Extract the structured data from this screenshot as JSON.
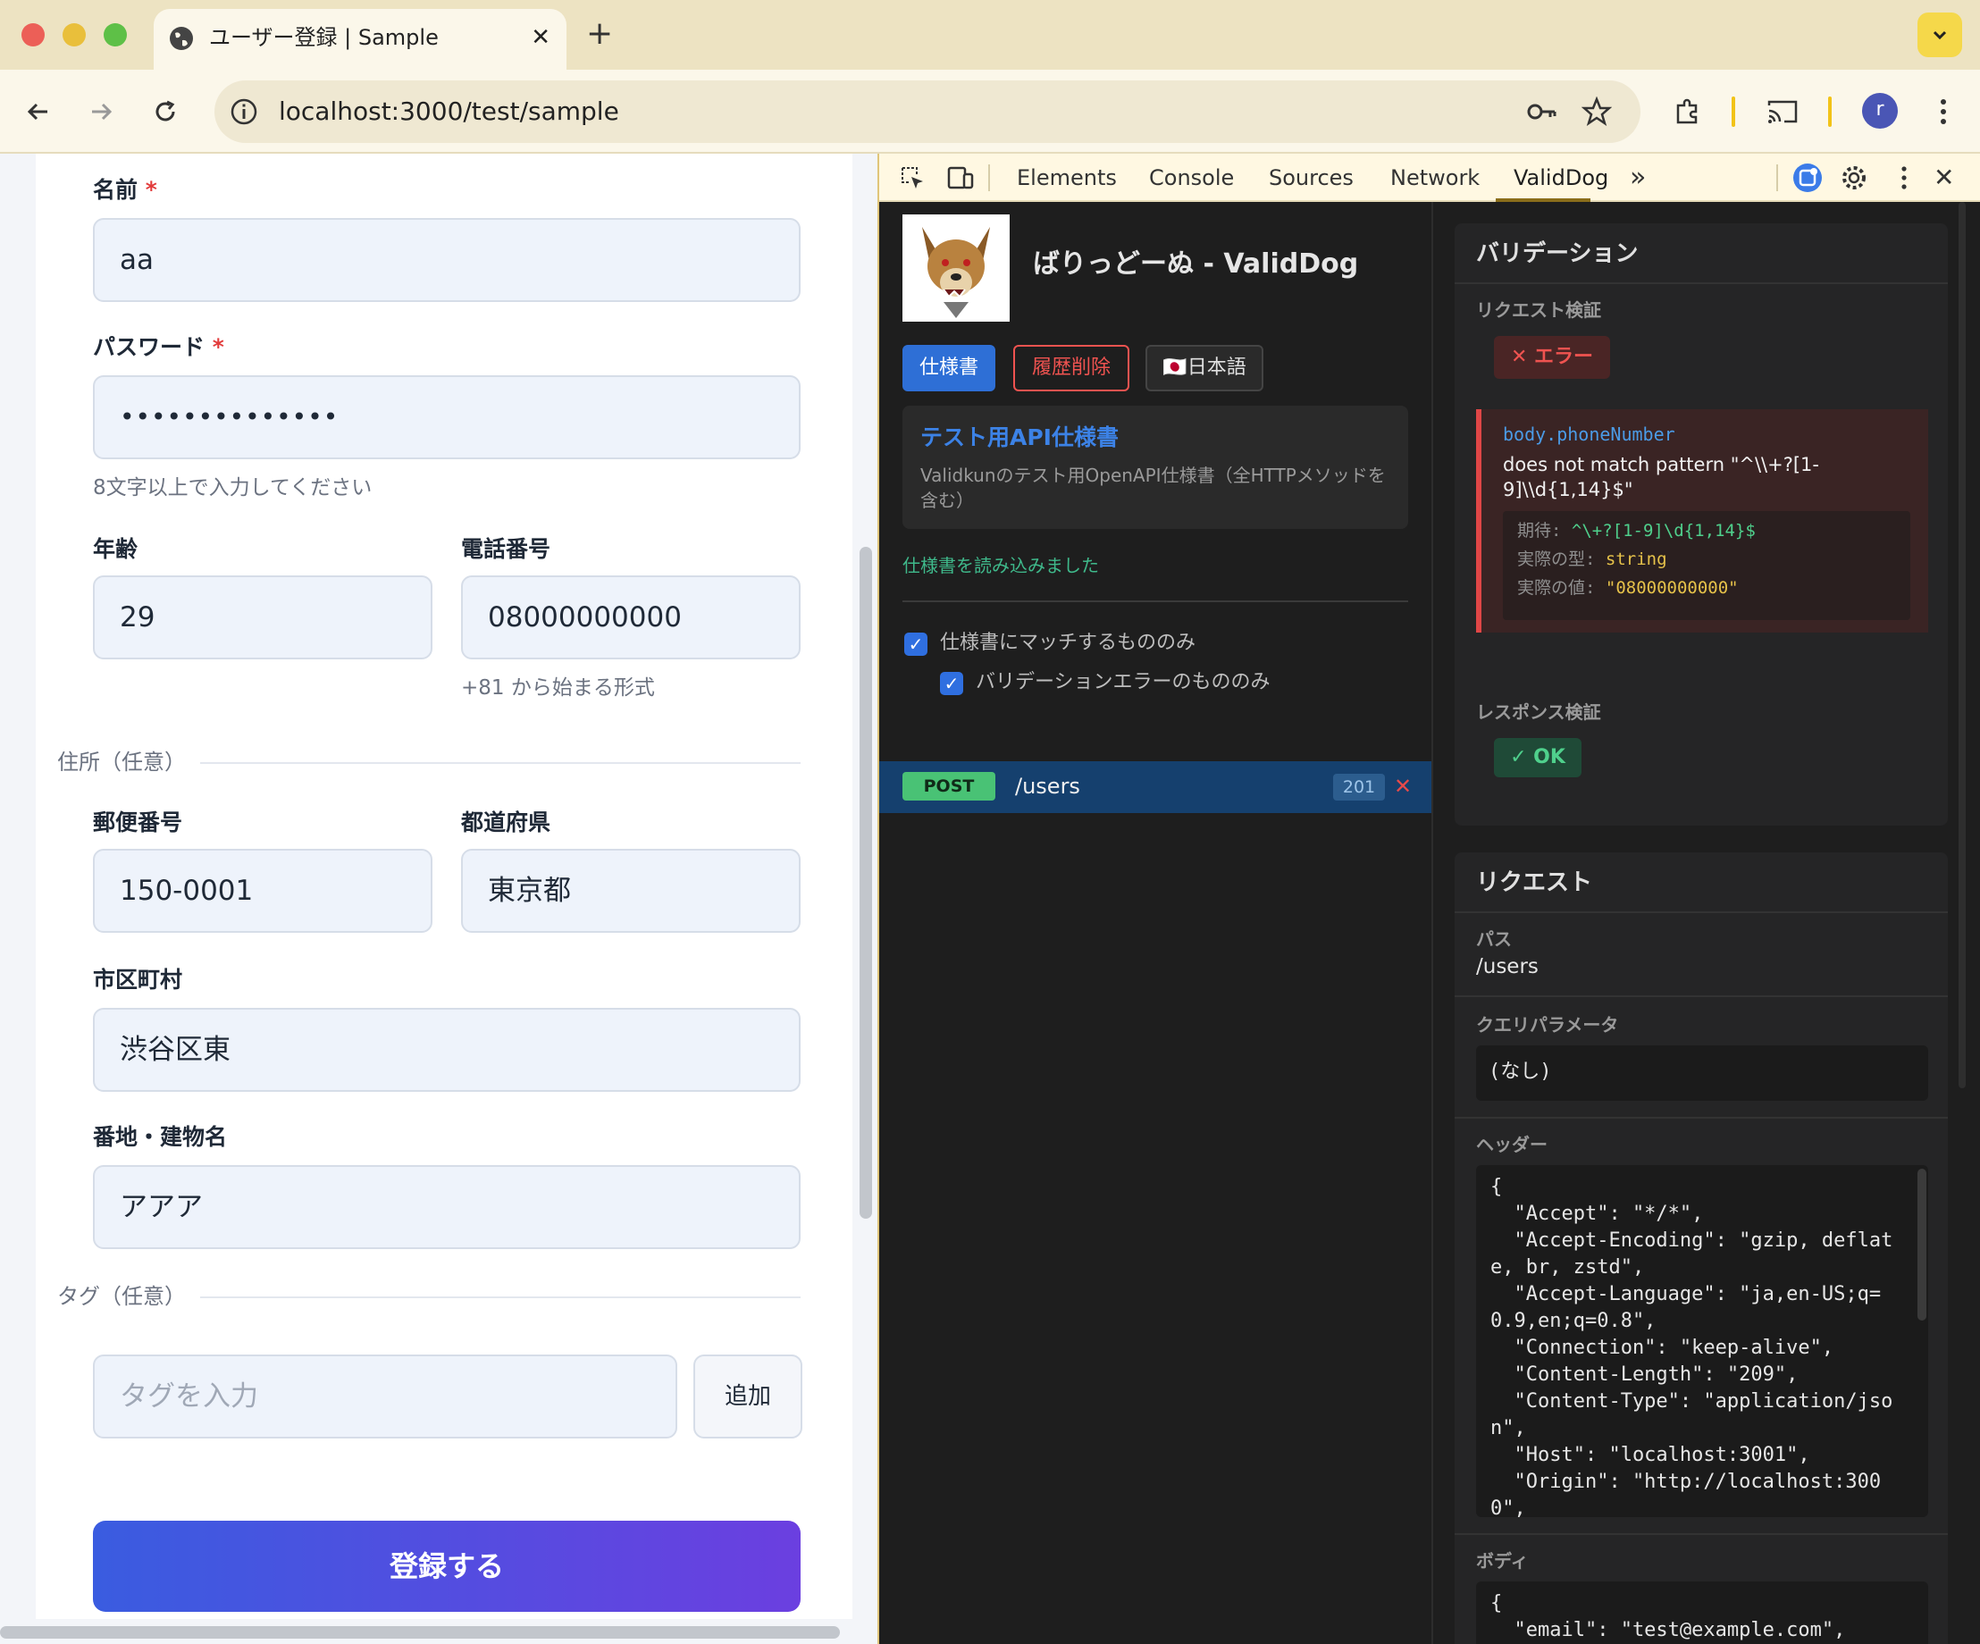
{
  "browser": {
    "tab_title": "ユーザー登録 | Sample",
    "tab_close": "✕",
    "new_tab": "+",
    "url": "localhost:3000/test/sample",
    "profile_initial": "r"
  },
  "form": {
    "name": {
      "label": "名前",
      "required_mark": "*",
      "value": "aa"
    },
    "password": {
      "label": "パスワード",
      "required_mark": "*",
      "value": "••••••••••••••",
      "hint": "8文字以上で入力してください"
    },
    "age": {
      "label": "年齢",
      "value": "29"
    },
    "phone": {
      "label": "電話番号",
      "value": "08000000000",
      "hint": "+81 から始まる形式"
    },
    "address_section": "住所（任意）",
    "postal": {
      "label": "郵便番号",
      "value": "150-0001"
    },
    "prefecture": {
      "label": "都道府県",
      "value": "東京都"
    },
    "city": {
      "label": "市区町村",
      "value": "渋谷区東"
    },
    "street": {
      "label": "番地・建物名",
      "value": "アアア"
    },
    "tags_section": "タグ（任意）",
    "tag_input": {
      "placeholder": "タグを入力"
    },
    "add_label": "追加",
    "submit_label": "登録する"
  },
  "devtools": {
    "tabs": [
      "Elements",
      "Console",
      "Sources",
      "Network",
      "ValidDog"
    ],
    "active_tab": "ValidDog",
    "more": "»",
    "close": "✕"
  },
  "validdog": {
    "title": "ばりっどーぬ - ValidDog",
    "btn_spec": "仕様書",
    "btn_clear": "履歴削除",
    "btn_lang": "🇯🇵日本語",
    "spec_title": "テスト用API仕様書",
    "spec_desc": "Validkunのテスト用OpenAPI仕様書（全HTTPメソッドを含む）",
    "loaded_msg": "仕様書を読み込みました",
    "filter_spec_only": "仕様書にマッチするもののみ",
    "filter_errors_only": "バリデーションエラーのもののみ",
    "request_row": {
      "method": "POST",
      "path": "/users",
      "status": "201",
      "remove": "✕"
    }
  },
  "validation": {
    "heading": "バリデーション",
    "request_label": "リクエスト検証",
    "request_badge": "✕ エラー",
    "error": {
      "field": "body.phoneNumber",
      "message": "does not match pattern \"^\\\\+?[1-9]\\\\d{1,14}$\"",
      "expected_key": "期待:",
      "expected_val": "^\\+?[1-9]\\d{1,14}$",
      "type_key": "実際の型:",
      "type_val": "string",
      "value_key": "実際の値:",
      "value_val": "\"08000000000\""
    },
    "response_label": "レスポンス検証",
    "response_badge": "✓ OK"
  },
  "request": {
    "heading": "リクエスト",
    "path_label": "パス",
    "path_value": "/users",
    "query_label": "クエリパラメータ",
    "query_value": "(なし)",
    "headers_label": "ヘッダー",
    "headers_code": "{\n  \"Accept\": \"*/*\",\n  \"Accept-Encoding\": \"gzip, deflat\ne, br, zstd\",\n  \"Accept-Language\": \"ja,en-US;q=\n0.9,en;q=0.8\",\n  \"Connection\": \"keep-alive\",\n  \"Content-Length\": \"209\",\n  \"Content-Type\": \"application/jso\nn\",\n  \"Host\": \"localhost:3001\",\n  \"Origin\": \"http://localhost:300\n0\",",
    "body_label": "ボディ",
    "body_code": "{\n  \"email\": \"test@example.com\","
  }
}
